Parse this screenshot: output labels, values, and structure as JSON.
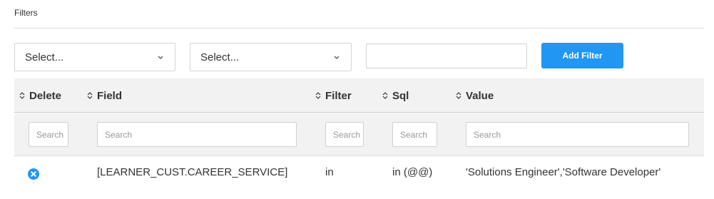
{
  "filters": {
    "title": "Filters",
    "field_select": {
      "value": "Select..."
    },
    "operator_select": {
      "value": "Select..."
    },
    "value_input": {
      "value": ""
    },
    "add_button_label": "Add Filter",
    "accent": "#2196f3"
  },
  "table": {
    "columns": [
      "Delete",
      "Field",
      "Filter",
      "Sql",
      "Value"
    ],
    "search_placeholders": [
      "Search",
      "Search",
      "Search",
      "Search",
      "Search"
    ],
    "rows": [
      {
        "delete_icon": "close-circle-icon",
        "field": "[LEARNER_CUST.CAREER_SERVICE]",
        "filter": "in",
        "sql": "in (@@)",
        "value": "'Solutions Engineer','Software Developer'"
      }
    ]
  }
}
